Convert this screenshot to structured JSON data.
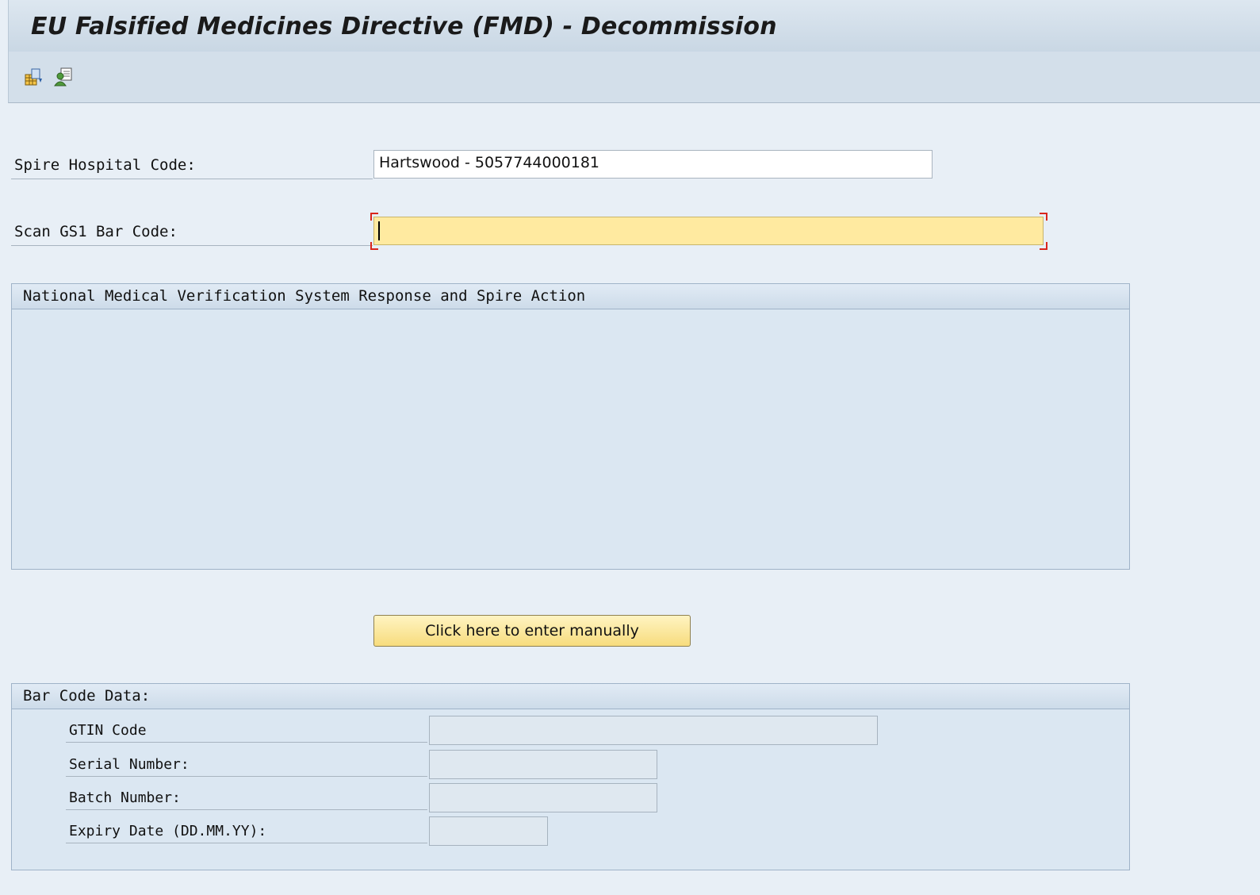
{
  "window": {
    "title": "EU Falsified Medicines Directive (FMD) - Decommission"
  },
  "toolbar": {
    "icons": [
      "table-layout-icon",
      "user-settings-icon"
    ]
  },
  "form": {
    "hospital_label": "Spire Hospital Code:",
    "hospital_value": "Hartswood - 5057744000181",
    "scan_label": "Scan GS1 Bar Code:",
    "scan_value": ""
  },
  "response_group": {
    "title": "National Medical Verification System Response and Spire Action"
  },
  "manual_button": {
    "label": "Click here to enter manually"
  },
  "barcode_group": {
    "title": "Bar Code Data:",
    "gtin_label": "GTIN Code",
    "gtin_value": "",
    "serial_label": "Serial Number:",
    "serial_value": "",
    "batch_label": "Batch Number:",
    "batch_value": "",
    "expiry_label": "Expiry Date (DD.MM.YY):",
    "expiry_value": ""
  },
  "colors": {
    "active_field": "#ffeaa0",
    "focus_corner": "#d9261c",
    "button": "#f7dc7d"
  }
}
